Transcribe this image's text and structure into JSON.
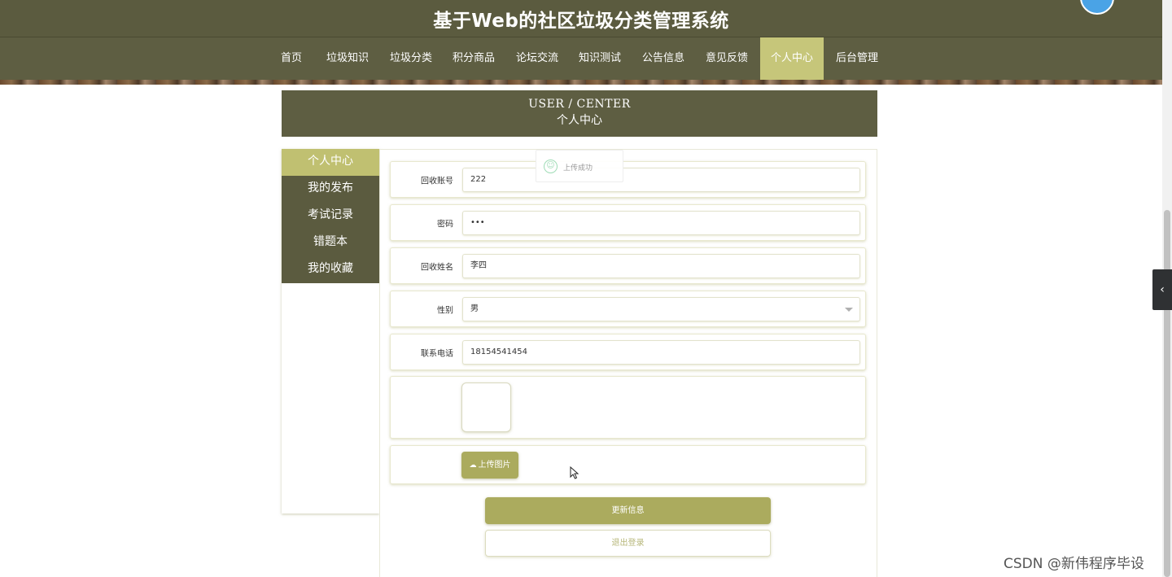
{
  "site": {
    "title": "基于Web的社区垃圾分类管理系统"
  },
  "nav": {
    "items": [
      {
        "label": "首页"
      },
      {
        "label": "垃圾知识"
      },
      {
        "label": "垃圾分类"
      },
      {
        "label": "积分商品"
      },
      {
        "label": "论坛交流"
      },
      {
        "label": "知识测试"
      },
      {
        "label": "公告信息"
      },
      {
        "label": "意见反馈"
      },
      {
        "label": "个人中心",
        "active": true
      },
      {
        "label": "后台管理"
      }
    ]
  },
  "center_header": {
    "en_title": "USER / CENTER",
    "cn_title": "个人中心"
  },
  "side_menu": {
    "items": [
      {
        "label": "个人中心",
        "active": true
      },
      {
        "label": "我的发布"
      },
      {
        "label": "考试记录"
      },
      {
        "label": "错题本"
      },
      {
        "label": "我的收藏"
      }
    ]
  },
  "form": {
    "account": {
      "label": "回收账号",
      "value": "222"
    },
    "password": {
      "label": "密码",
      "value": "•••"
    },
    "name": {
      "label": "回收姓名",
      "value": "李四"
    },
    "gender": {
      "label": "性别",
      "value": "男"
    },
    "phone": {
      "label": "联系电话",
      "value": "18154541454"
    },
    "upload_label": "上传图片",
    "update_label": "更新信息",
    "logout_label": "退出登录"
  },
  "toast": {
    "message": "上传成功"
  },
  "side_toggle": {
    "icon": "‹"
  },
  "watermark": {
    "text": "CSDN @新伟程序毕设"
  },
  "colors": {
    "header_bg": "#5b5b3f",
    "accent": "#c6c67a",
    "button": "#abab5e"
  }
}
